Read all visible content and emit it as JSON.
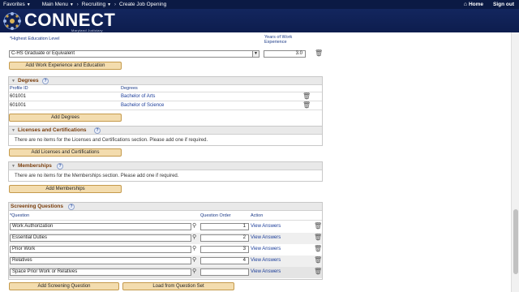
{
  "nav": {
    "favorites": "Favorites",
    "main_menu": "Main Menu",
    "recruiting": "Recruiting",
    "create_job": "Create Job Opening",
    "home": "Home",
    "sign_out": "Sign out",
    "separator": ">"
  },
  "brand": {
    "name": "CONNECT",
    "subtitle": "Maryland Judiciary"
  },
  "education": {
    "highest_level_label": "*Highest Education Level",
    "years_label": "Years of Work Experience",
    "highest_level_value": "C-HS Graduate or Equivalent",
    "years_value": "3.0",
    "add_button": "Add Work Experience and Education"
  },
  "degrees": {
    "title": "Degrees",
    "col_profile_id": "Profile ID",
    "col_degrees": "Degrees",
    "rows": [
      {
        "profile_id": "601001",
        "degree": "Bachelor of Arts"
      },
      {
        "profile_id": "601001",
        "degree": "Bachelor of Science"
      }
    ],
    "add_button": "Add Degrees"
  },
  "licenses": {
    "title": "Licenses and Certifications",
    "message": "There are no items for the Licenses and Certifications section.  Please add one if required.",
    "add_button": "Add Licenses and Certifications"
  },
  "memberships": {
    "title": "Memberships",
    "message": "There are no items for the Memberships section.  Please add one if required.",
    "add_button": "Add Memberships"
  },
  "screening": {
    "title": "Screening Questions",
    "col_question": "*Question",
    "col_order": "Question Order",
    "col_action": "Action",
    "rows": [
      {
        "question": "Work Authorization",
        "order": "1",
        "action": "View Answers"
      },
      {
        "question": "Essential Duties",
        "order": "2",
        "action": "View Answers"
      },
      {
        "question": "Prior Work",
        "order": "3",
        "action": "View Answers"
      },
      {
        "question": "Relatives",
        "order": "4",
        "action": "View Answers"
      },
      {
        "question": "Space Prior Work or Relatives",
        "order": "",
        "action": "View Answers"
      }
    ],
    "add_button": "Add Screening Question",
    "load_button": "Load from Question Set"
  },
  "colors": {
    "nav_bg": "#0b1a44",
    "brand_bg": "#13265e",
    "button_bg": "#f3dcae",
    "section_title": "#7a3d0a",
    "link": "#1a3c99"
  }
}
